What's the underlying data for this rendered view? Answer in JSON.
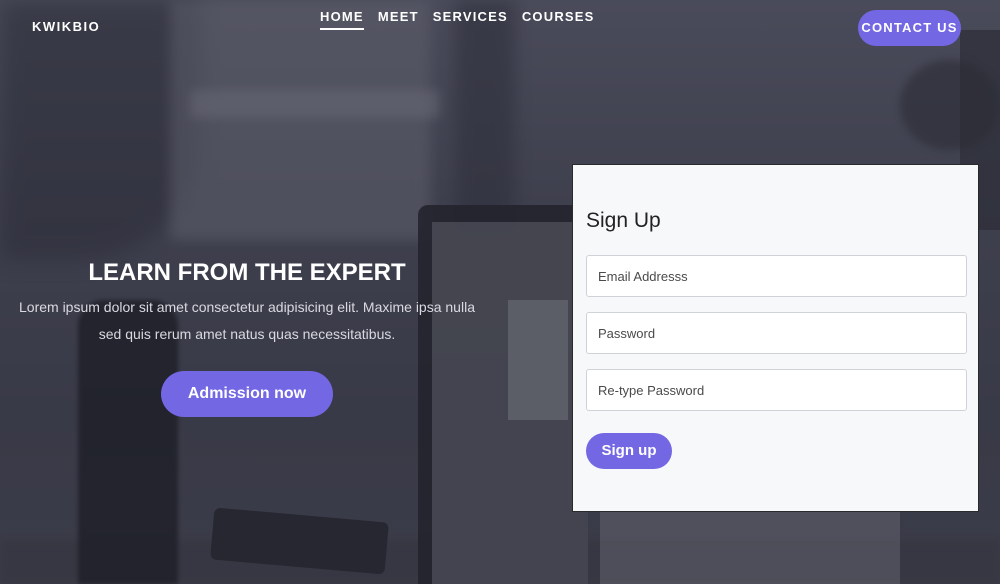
{
  "header": {
    "brand": "KWIKBIO",
    "nav": [
      {
        "label": "HOME",
        "active": true
      },
      {
        "label": "MEET",
        "active": false
      },
      {
        "label": "SERVICES",
        "active": false
      },
      {
        "label": "COURSES",
        "active": false
      }
    ],
    "contact_label": "CONTACT US"
  },
  "hero": {
    "title": "LEARN FROM THE EXPERT",
    "text": "Lorem ipsum dolor sit amet consectetur adipisicing elit. Maxime ipsa nulla sed quis rerum amet natus quas necessitatibus.",
    "cta_label": "Admission now"
  },
  "signup": {
    "title": "Sign Up",
    "email_placeholder": "Email Addresss",
    "password_placeholder": "Password",
    "retype_placeholder": "Re-type Password",
    "submit_label": "Sign up"
  },
  "colors": {
    "accent": "#7367e3",
    "overlay": "#3d3e4c",
    "card_bg": "#f7f8fa"
  }
}
